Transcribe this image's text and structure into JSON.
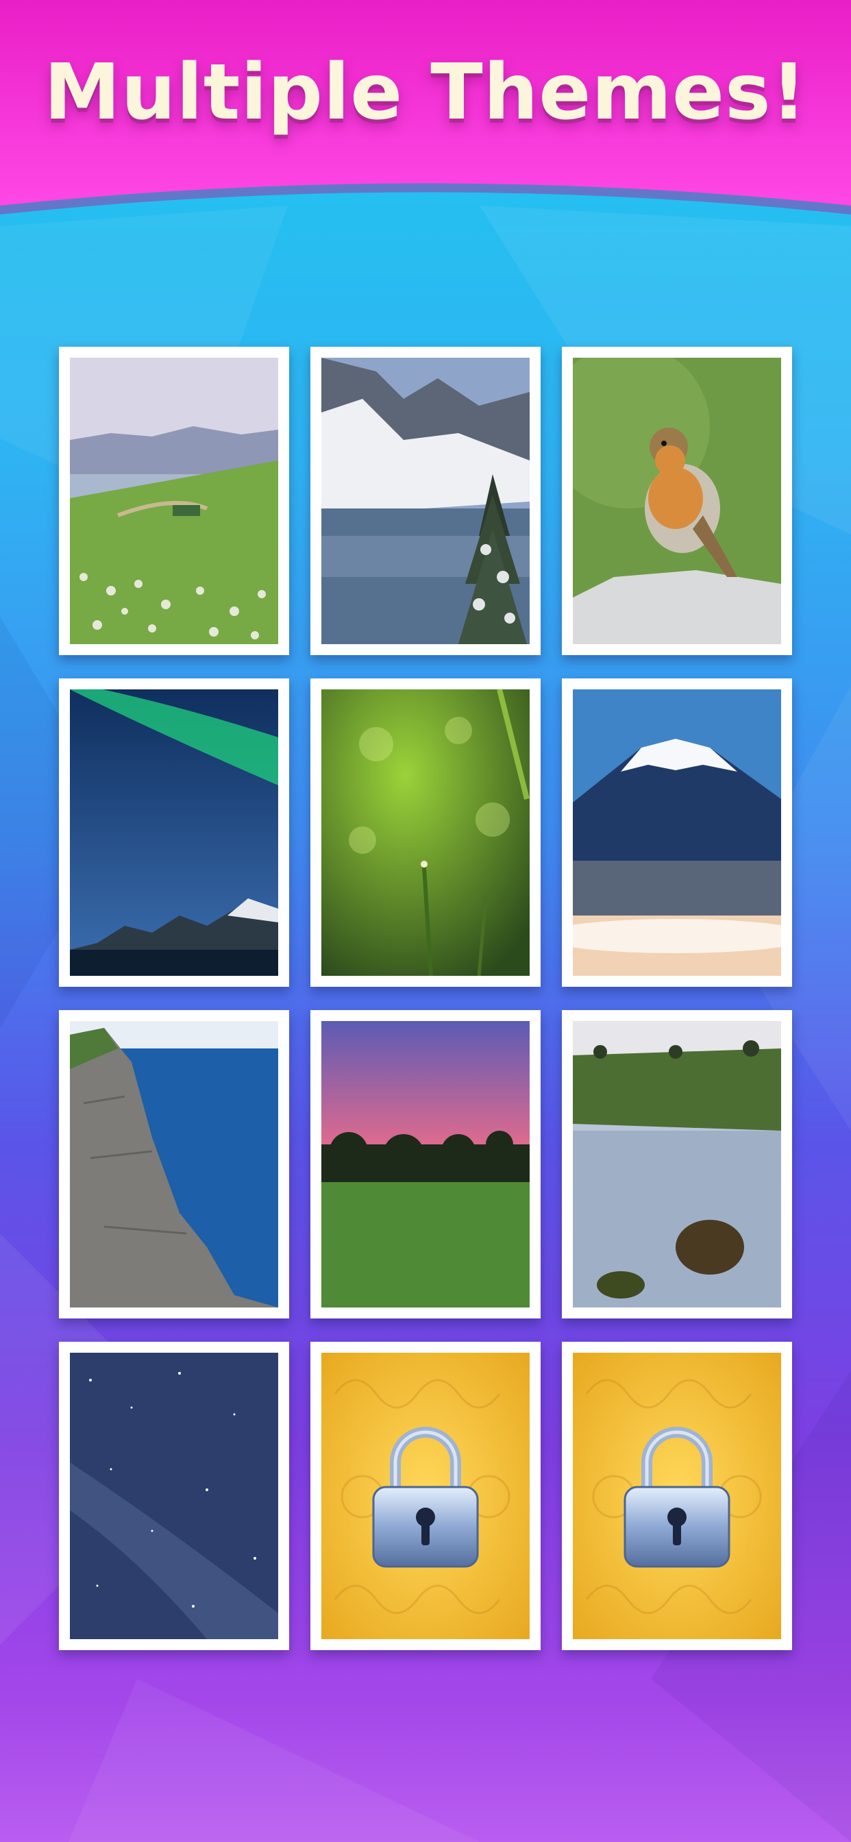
{
  "header": {
    "title": "Multiple Themes!"
  },
  "colors": {
    "banner_top": "#e91fc6",
    "banner_bottom": "#ff48e6",
    "sky_blue": "#1ec8f0",
    "violet": "#7d3fe2"
  },
  "themes": [
    {
      "name": "meadow-lake-theme",
      "locked": false
    },
    {
      "name": "snowy-mountain-lake-theme",
      "locked": false
    },
    {
      "name": "robin-bird-theme",
      "locked": false
    },
    {
      "name": "aurora-night-theme",
      "locked": false
    },
    {
      "name": "dewy-grass-theme",
      "locked": false
    },
    {
      "name": "mount-fuji-theme",
      "locked": false
    },
    {
      "name": "sea-cliff-theme",
      "locked": false
    },
    {
      "name": "sunset-savanna-theme",
      "locked": false
    },
    {
      "name": "reflection-pond-theme",
      "locked": false
    },
    {
      "name": "starry-sky-theme",
      "locked": false
    },
    {
      "name": "locked-theme",
      "locked": true,
      "icon": "padlock-icon"
    },
    {
      "name": "locked-theme",
      "locked": true,
      "icon": "padlock-icon"
    }
  ]
}
